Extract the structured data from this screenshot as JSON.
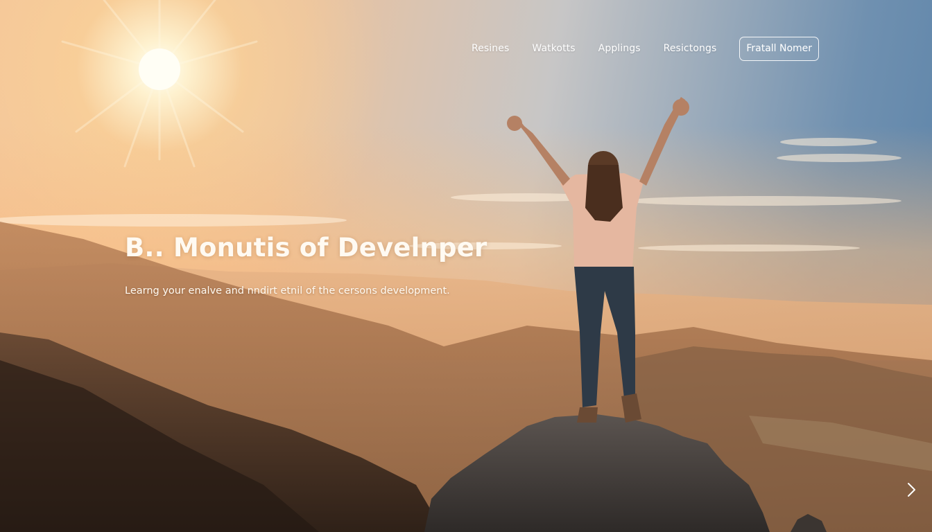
{
  "nav": {
    "links": [
      "Resines",
      "Watkotts",
      "Applings",
      "Resictongs"
    ],
    "cta_label": "Fratall Nomer"
  },
  "hero": {
    "title": "B.. Monutis of Develnper",
    "subtitle": "Learng your enalve and nndirt etnil of the cersons development."
  },
  "icons": {
    "next": "chevron-right-icon"
  },
  "colors": {
    "text": "#fffaf2",
    "sky_warm": "#f3c59a",
    "sky_cool": "#5a82a8"
  }
}
